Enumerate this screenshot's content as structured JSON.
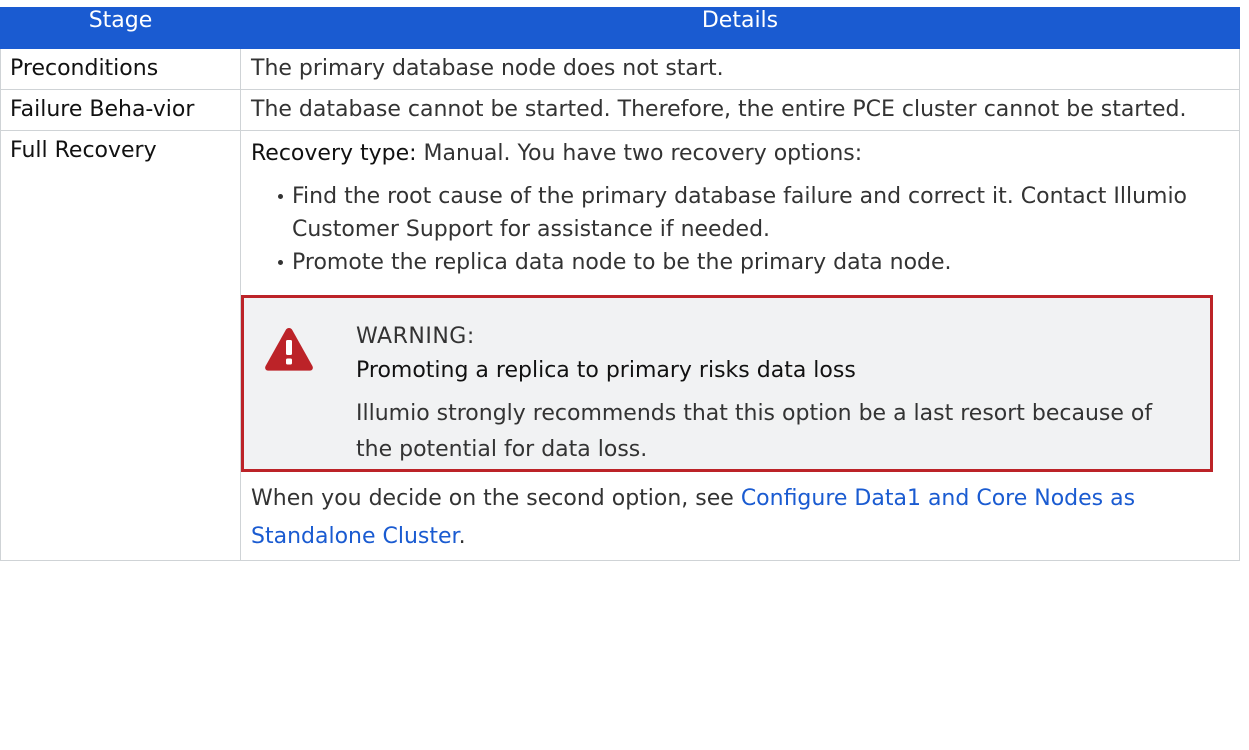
{
  "table": {
    "headers": {
      "stage": "Stage",
      "details": "Details"
    },
    "rows": [
      {
        "stage": "Preconditions",
        "details": "The primary database node does not start."
      },
      {
        "stage": "Failure Beha-vior",
        "details": "The database cannot be started. Therefore, the entire PCE cluster cannot be started."
      },
      {
        "stage": "Full Recovery",
        "recovery_type_label": "Recovery type:",
        "recovery_type_text": " Manual. You have two recovery options:",
        "options": [
          "Find the root cause of the primary database failure and correct it. Contact Illumio Customer Support for assistance if needed.",
          "Promote the replica data node to be the primary data node."
        ],
        "warning": {
          "icon": "warning-triangle-icon",
          "heading": "WARNING:",
          "title": "Promoting a replica to primary risks data loss",
          "body": "Illumio strongly recommends that this option be a last resort because of the potential for data loss."
        },
        "closing_text": "When you decide on the second option, see ",
        "closing_link": "Configure Data1 and Core Nodes as Standalone Cluster",
        "closing_end": "."
      }
    ]
  },
  "colors": {
    "header_bg": "#1a5bd1",
    "link": "#1a5bd1",
    "warning_border": "#bc2328",
    "warning_bg": "#f1f2f3"
  }
}
